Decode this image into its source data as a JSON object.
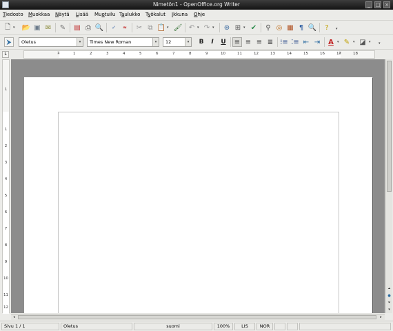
{
  "window": {
    "title": "Nimetön1 - OpenOffice.org Writer"
  },
  "menu": [
    {
      "label": "Tiedosto",
      "acc": "T",
      "rest": "iedosto"
    },
    {
      "label": "Muokkaa",
      "acc": "M",
      "rest": "uokkaa"
    },
    {
      "label": "Näytä",
      "acc": "N",
      "rest": "äytä"
    },
    {
      "label": "Lisää",
      "acc": "L",
      "rest": "isää"
    },
    {
      "label": "Muotoilu",
      "acc": "o",
      "pre": "Mu",
      "rest": "tuilu"
    },
    {
      "label": "Taulukko",
      "acc": "a",
      "pre": "T",
      "rest": "ulukko"
    },
    {
      "label": "Työkalut",
      "acc": "y",
      "pre": "T",
      "rest": "ökalut"
    },
    {
      "label": "Ikkuna",
      "acc": "I",
      "rest": "kkuna"
    },
    {
      "label": "Ohje",
      "acc": "O",
      "rest": "hje"
    }
  ],
  "toolbar_icons": [
    "new-icon",
    "open-icon",
    "save-icon",
    "email-icon",
    "edit-file-icon",
    "export-pdf-icon",
    "print-icon",
    "page-preview-icon",
    "spellcheck-icon",
    "autospellcheck-icon",
    "cut-icon",
    "copy-icon",
    "paste-icon",
    "clone-format-icon",
    "undo-icon",
    "redo-icon",
    "hyperlink-icon",
    "table-icon",
    "show-draw-functions-icon",
    "find-replace-icon",
    "navigator-icon",
    "gallery-icon",
    "nonprinting-chars-icon",
    "zoom-icon",
    "help-icon"
  ],
  "format": {
    "style": "Oletus",
    "font": "Times New Roman",
    "size": "12"
  },
  "ruler": {
    "h_labels": [
      "1",
      "2",
      "3",
      "4",
      "5",
      "6",
      "7",
      "8",
      "9",
      "10",
      "11",
      "12",
      "13",
      "14",
      "15",
      "16",
      "17",
      "18"
    ],
    "v_labels": [
      "1",
      "1",
      "2",
      "3",
      "4",
      "5",
      "6",
      "7",
      "8",
      "9",
      "10",
      "11",
      "12"
    ]
  },
  "status": {
    "page": "Sivu 1 / 1",
    "style": "Oletus",
    "language": "suomi",
    "zoom": "100%",
    "insert_mode": "LIS",
    "selection_mode": "NOR"
  }
}
